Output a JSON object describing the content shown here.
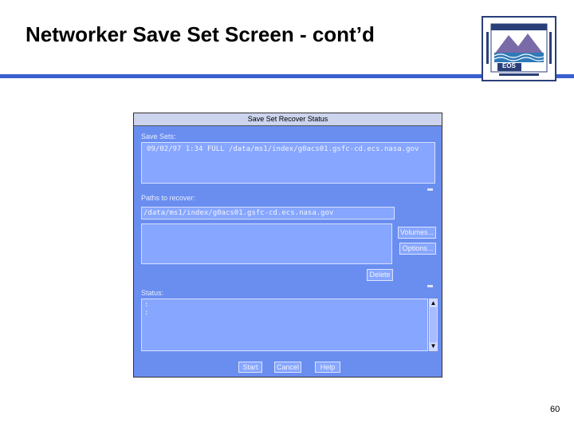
{
  "slide": {
    "title": "Networker Save Set Screen - cont’d",
    "page_number": "60",
    "logo_text": "EOS"
  },
  "dialog": {
    "title": "Save Set Recover Status",
    "save_sets_label": "Save Sets:",
    "save_sets_entry": "09/02/97  1:34 FULL /data/ms1/index/g0acs01.gsfc-cd.ecs.nasa.gov",
    "paths_label": "Paths to recover:",
    "path_entry": "/data/ms1/index/g0acs01.gsfc-cd.ecs.nasa.gov",
    "volumes_button": "Volumes...",
    "options_button": "Options...",
    "delete_button": "Delete",
    "status_label": "Status:",
    "status_lines": [
      ":",
      ":"
    ],
    "start_button": "Start",
    "cancel_button": "Cancel",
    "help_button": "Help"
  },
  "colors": {
    "window_bg": "#6a8ef0",
    "field_bg": "#86a6ff",
    "rule": "#3a5fcd"
  }
}
